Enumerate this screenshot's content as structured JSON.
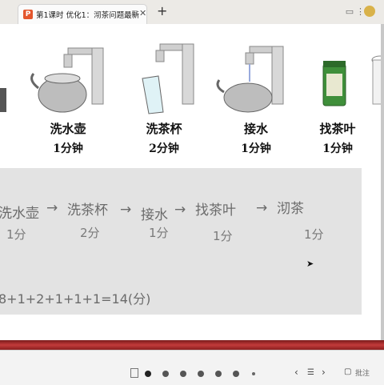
{
  "tab": {
    "title": "第1课时 优化1：沏茶问题最新",
    "app_icon": "P"
  },
  "toolbar_icons": [
    "layout-icon",
    "window-icon",
    "avatar"
  ],
  "steps": [
    {
      "label": "洗水壶",
      "time": "1分钟"
    },
    {
      "label": "洗茶杯",
      "time": "2分钟"
    },
    {
      "label": "接水",
      "time": "1分钟"
    },
    {
      "label": "找茶叶",
      "time": "1分钟"
    }
  ],
  "handwriting": {
    "tasks": [
      "洗水壶",
      "洗茶杯",
      "接水",
      "找茶叶",
      "沏茶"
    ],
    "times": [
      "1分",
      "2分",
      "1分",
      "1分",
      "1分"
    ],
    "arrow": "→",
    "equation": "8+1+2+1+1+1=14(分)"
  },
  "bottom": {
    "page_dots": 7,
    "prev_label": "‹",
    "next_label": "›",
    "comment_label": "批注"
  },
  "colors": {
    "accent_red": "#c23a3a",
    "tab_bg": "#eceae6",
    "board_bg": "#e3e3e3"
  }
}
